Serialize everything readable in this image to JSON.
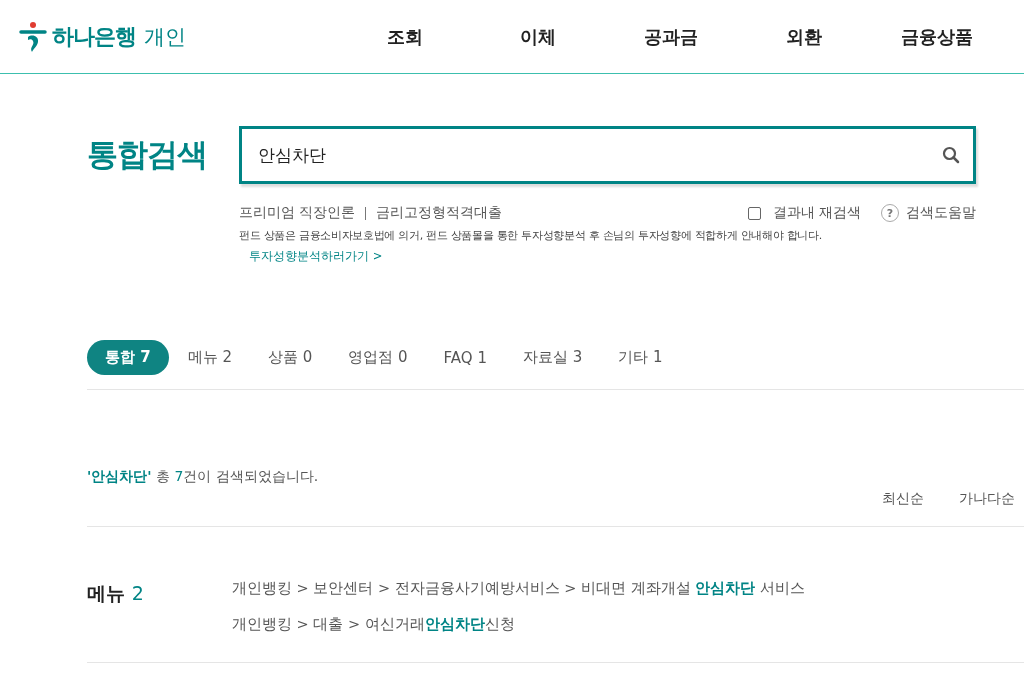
{
  "header": {
    "logo": "하나은행",
    "section": "개인",
    "nav": [
      "조회",
      "이체",
      "공과금",
      "외환",
      "금융상품"
    ]
  },
  "search": {
    "title": "통합검색",
    "value": "안심차단",
    "suggestions": [
      "프리미엄 직장인론",
      "금리고정형적격대출"
    ],
    "research": {
      "label": "결과내 재검색",
      "checked": false
    },
    "help": {
      "icon": "?",
      "label": "검색도움말"
    },
    "notice": "펀드 상품은 금융소비자보호법에 의거, 펀드 상품몰을 통한 투자성향분석 후 손님의 투자성향에 적합하게 안내해야 합니다.",
    "notice_link": "투자성향분석하러가기 >"
  },
  "tabs": [
    {
      "label": "통합 7",
      "selected": true
    },
    {
      "label": "메뉴 2",
      "selected": false
    },
    {
      "label": "상품 0",
      "selected": false
    },
    {
      "label": "영업점 0",
      "selected": false
    },
    {
      "label": "FAQ 1",
      "selected": false
    },
    {
      "label": "자료실 3",
      "selected": false
    },
    {
      "label": "기타 1",
      "selected": false
    }
  ],
  "summary": {
    "query": "'안심차단'",
    "before": " 총 ",
    "count": "7",
    "after": "건이 검색되었습니다."
  },
  "sort": [
    "최신순",
    "가나다순"
  ],
  "sections": [
    {
      "title": "메뉴",
      "count": "2",
      "results": [
        "개인뱅킹 > 보안센터 > 전자금융사기예방서비스 > 비대면 계좌개설 **안심차단** 서비스",
        "개인뱅킹 > 대출 > 여신거래**안심차단**신청"
      ]
    }
  ]
}
